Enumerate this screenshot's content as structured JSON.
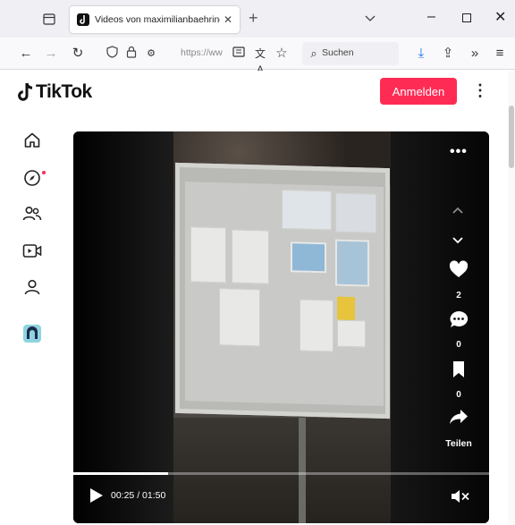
{
  "browser": {
    "tab_title": "Videos von maximilianbaehring",
    "url": "https://ww",
    "search_placeholder": "Suchen"
  },
  "header": {
    "logo_text": "TikTok",
    "login_label": "Anmelden",
    "accent_color": "#fe2c55"
  },
  "sidebar": {
    "items": [
      {
        "icon": "home-icon"
      },
      {
        "icon": "explore-icon"
      },
      {
        "icon": "following-icon"
      },
      {
        "icon": "live-icon"
      },
      {
        "icon": "profile-icon"
      },
      {
        "icon": "account-avatar"
      }
    ]
  },
  "video": {
    "likes": "2",
    "comments": "0",
    "saves": "0",
    "share_label": "Teilen",
    "time_text": "00:25 / 01:50",
    "progress": 0.227,
    "muted": true
  }
}
